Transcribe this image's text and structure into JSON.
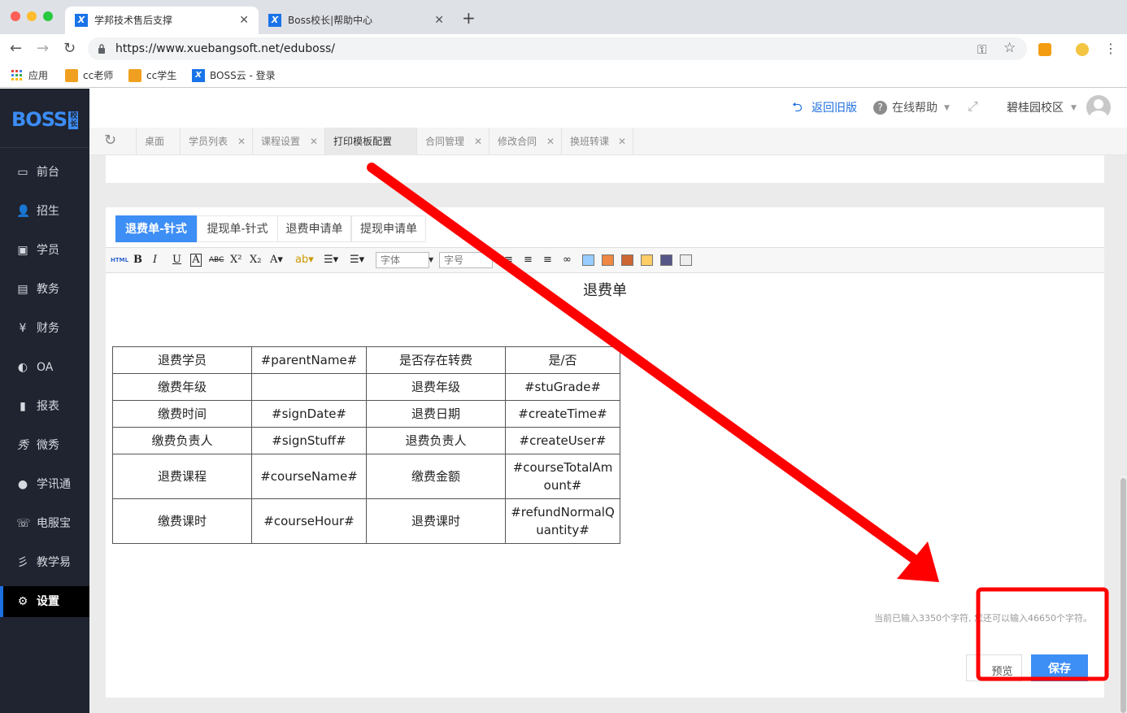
{
  "browser": {
    "tabs": [
      {
        "title": "学邦技术售后支撑",
        "favicon": "X"
      },
      {
        "title": "Boss校长|帮助中心",
        "favicon": "X"
      }
    ],
    "url": "https://www.xuebangsoft.net/eduboss/",
    "bookmarks": [
      {
        "label": "应用",
        "icon": "apps-grid-icon"
      },
      {
        "label": "cc老师",
        "icon": "cc-teacher-icon"
      },
      {
        "label": "cc学生",
        "icon": "cc-student-icon"
      },
      {
        "label": "BOSS云 - 登录",
        "icon": "boss-cloud-icon"
      }
    ]
  },
  "sidebar": {
    "logo": "BOSS",
    "logo_badge": "校长",
    "items": [
      {
        "label": "前台",
        "icon": "calendar-icon"
      },
      {
        "label": "招生",
        "icon": "user-plus-icon"
      },
      {
        "label": "学员",
        "icon": "student-card-icon"
      },
      {
        "label": "教务",
        "icon": "book-icon"
      },
      {
        "label": "财务",
        "icon": "yen-icon"
      },
      {
        "label": "OA",
        "icon": "oa-icon"
      },
      {
        "label": "报表",
        "icon": "bar-chart-icon"
      },
      {
        "label": "微秀",
        "icon": "weixiu-icon"
      },
      {
        "label": "学讯通",
        "icon": "location-pin-icon"
      },
      {
        "label": "电服宝",
        "icon": "phone-icon"
      },
      {
        "label": "教学易",
        "icon": "teaching-icon"
      },
      {
        "label": "设置",
        "icon": "gear-icon"
      }
    ],
    "active_index": 11
  },
  "header": {
    "back_old": "返回旧版",
    "help": "在线帮助",
    "campus": "碧桂园校区"
  },
  "page_tabs": [
    {
      "label": "桌面",
      "closable": false
    },
    {
      "label": "学员列表",
      "closable": true
    },
    {
      "label": "课程设置",
      "closable": true
    },
    {
      "label": "打印模板配置",
      "closable": false,
      "active": true
    },
    {
      "label": "合同管理",
      "closable": true
    },
    {
      "label": "修改合同",
      "closable": true
    },
    {
      "label": "换班转课",
      "closable": true
    }
  ],
  "form_tabs": [
    {
      "label": "退费单-针式",
      "active": true
    },
    {
      "label": "提现单-针式"
    },
    {
      "label": "退费申请单"
    },
    {
      "label": "提现申请单"
    }
  ],
  "toolbar": {
    "html": "HTML",
    "font_placeholder": "字体",
    "size_placeholder": "字号"
  },
  "document": {
    "title": "退费单",
    "rows": [
      [
        "退费学员",
        "#parentName#",
        "是否存在转费",
        "是/否"
      ],
      [
        "缴费年级",
        "",
        "退费年级",
        "#stuGrade#"
      ],
      [
        "缴费时间",
        "#signDate#",
        "退费日期",
        "#createTime#"
      ],
      [
        "缴费负责人",
        "#signStuff#",
        "退费负责人",
        "#createUser#"
      ],
      [
        "退费课程",
        "#courseName#",
        "缴费金额",
        "#courseTotalAmount#"
      ],
      [
        "缴费课时",
        "#courseHour#",
        "退费课时",
        "#refundNormalQuantity#"
      ]
    ]
  },
  "counter_text": "当前已输入3350个字符, 您还可以输入46650个字符。",
  "buttons": {
    "preview": "预览",
    "save": "保存"
  },
  "colors": {
    "accent": "#3d8ef5",
    "sidebar_bg": "#1f2430",
    "annotation_red": "#ff0000"
  }
}
